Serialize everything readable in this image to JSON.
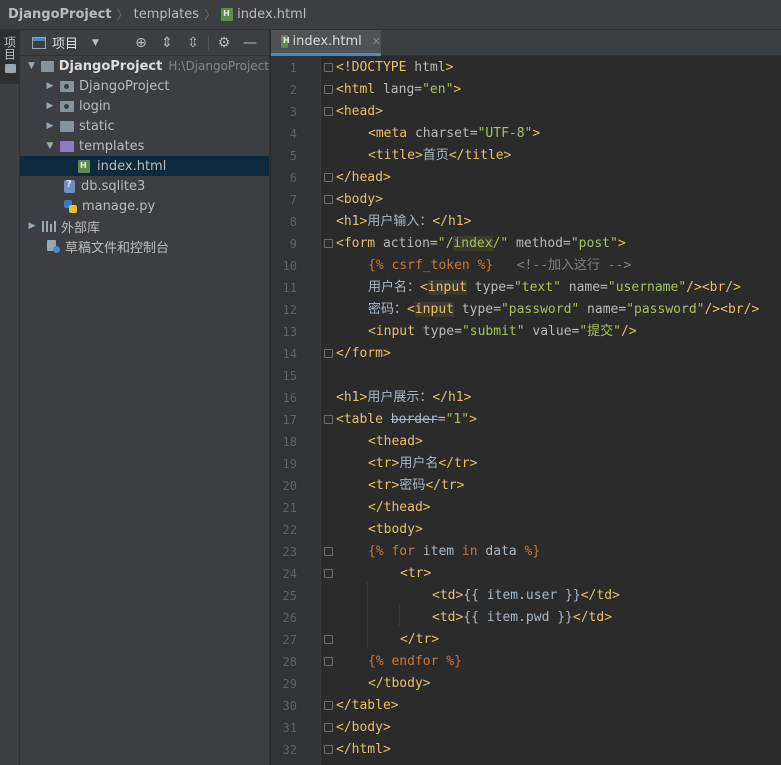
{
  "breadcrumb": {
    "project": "DjangoProject",
    "folder": "templates",
    "file": "index.html"
  },
  "tool_strip": {
    "project_tab": "项目"
  },
  "project_panel": {
    "title": "项目",
    "tree": {
      "root": {
        "label": "DjangoProject",
        "path": "H:\\DjangoProject"
      },
      "items": [
        {
          "label": "DjangoProject"
        },
        {
          "label": "login"
        },
        {
          "label": "static"
        },
        {
          "label": "templates"
        },
        {
          "label": "index.html"
        },
        {
          "label": "db.sqlite3"
        },
        {
          "label": "manage.py"
        }
      ],
      "external_libs": "外部库",
      "scratches": "草稿文件和控制台"
    }
  },
  "editor": {
    "tab_label": "index.html",
    "line_numbers": [
      "1",
      "2",
      "3",
      "4",
      "5",
      "6",
      "7",
      "8",
      "9",
      "10",
      "11",
      "12",
      "13",
      "14",
      "15",
      "16",
      "17",
      "18",
      "19",
      "20",
      "21",
      "22",
      "23",
      "24",
      "25",
      "26",
      "27",
      "28",
      "29",
      "30",
      "31",
      "32"
    ],
    "code": {
      "l1": [
        "<!DOCTYPE",
        " html",
        ">"
      ],
      "l2": [
        "<html",
        " lang=",
        "\"en\"",
        ">"
      ],
      "l3": [
        "<head>"
      ],
      "l4": [
        "<meta",
        " charset=",
        "\"UTF-8\"",
        ">"
      ],
      "l5": [
        "<title>",
        "首页",
        "</title>"
      ],
      "l6": [
        "</head>"
      ],
      "l7": [
        "<body>"
      ],
      "l8": [
        "<h1>",
        "用户输入：",
        "</h1>"
      ],
      "l9": [
        "<form",
        " action=",
        "\"/",
        "index",
        "/\"",
        " method=",
        "\"post\"",
        ">"
      ],
      "l10": [
        "{%",
        " csrf_token",
        " %}",
        "   <!--加入这行 -->"
      ],
      "l11": [
        "用户名：",
        "<",
        "input",
        " type=",
        "\"text\"",
        " name=",
        "\"username\"",
        "/>",
        "<br/>"
      ],
      "l12": [
        "密码：",
        "<",
        "input",
        " type=",
        "\"password\"",
        " name=",
        "\"password\"",
        "/>",
        "<br/>"
      ],
      "l13": [
        "<input",
        " type=",
        "\"submit\"",
        " value=",
        "\"提交\"",
        "/>"
      ],
      "l14": [
        "</form>"
      ],
      "l16": [
        "<h1>",
        "用户展示：",
        "</h1>"
      ],
      "l17": [
        "<table",
        " ",
        "border",
        "=",
        "\"1\"",
        ">"
      ],
      "l18": [
        "<thead>"
      ],
      "l19": [
        "<tr>",
        "用户名",
        "</tr>"
      ],
      "l20": [
        "<tr>",
        "密码",
        "</tr>"
      ],
      "l21": [
        "</thead>"
      ],
      "l22": [
        "<tbody>"
      ],
      "l23": [
        "{%",
        " for",
        " item",
        " in",
        " data",
        " %}"
      ],
      "l24": [
        "<tr>"
      ],
      "l25": [
        "<td>",
        "{{ item.user }}",
        "</td>"
      ],
      "l26": [
        "<td>",
        "{{ item.pwd }}",
        "</td>"
      ],
      "l27": [
        "</tr>"
      ],
      "l28": [
        "{%",
        " endfor",
        " %}"
      ],
      "l29": [
        "</tbody>"
      ],
      "l30": [
        "</table>"
      ],
      "l31": [
        "</body>"
      ],
      "l32": [
        "</html>"
      ]
    }
  }
}
